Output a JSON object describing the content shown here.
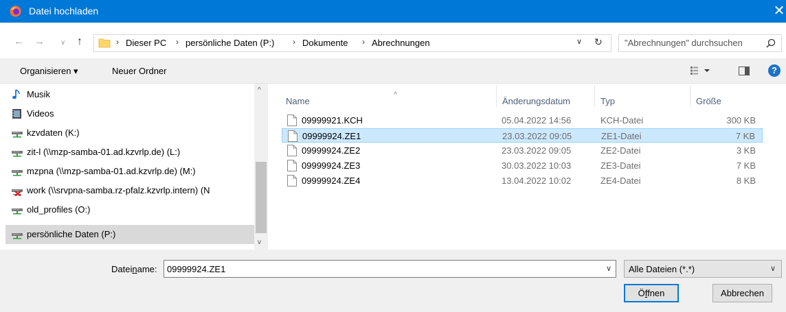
{
  "window": {
    "title": "Datei hochladen",
    "close": "✕"
  },
  "address": {
    "crumbs": [
      "Dieser PC",
      "persönliche Daten (P:)",
      "Dokumente",
      "Abrechnungen"
    ],
    "separator": "›",
    "search_placeholder": "\"Abrechnungen\" durchsuchen"
  },
  "toolbar": {
    "organize": "Organisieren ▾",
    "new_folder": "Neuer Ordner"
  },
  "nav": {
    "items": [
      {
        "label": "Musik",
        "icon": "music-icon"
      },
      {
        "label": "Videos",
        "icon": "video-icon"
      },
      {
        "label": "kzvdaten (K:)",
        "icon": "network-drive-icon"
      },
      {
        "label": "zit-l (\\\\mzp-samba-01.ad.kzvrlp.de) (L:)",
        "icon": "network-drive-icon"
      },
      {
        "label": "mzpna (\\\\mzp-samba-01.ad.kzvrlp.de) (M:)",
        "icon": "network-drive-icon"
      },
      {
        "label": "work (\\\\srvpna-samba.rz-pfalz.kzvrlp.intern) (N",
        "icon": "disconnected-drive-icon"
      },
      {
        "label": "old_profiles (O:)",
        "icon": "network-drive-icon"
      },
      {
        "label": "persönliche Daten (P:)",
        "icon": "network-drive-icon"
      }
    ],
    "selected_index": 7
  },
  "files": {
    "columns": {
      "name": "Name",
      "date": "Änderungsdatum",
      "type": "Typ",
      "size": "Größe"
    },
    "rows": [
      {
        "name": "09999921.KCH",
        "date": "05.04.2022 14:56",
        "type": "KCH-Datei",
        "size": "300 KB"
      },
      {
        "name": "09999924.ZE1",
        "date": "23.03.2022 09:05",
        "type": "ZE1-Datei",
        "size": "7 KB"
      },
      {
        "name": "09999924.ZE2",
        "date": "23.03.2022 09:05",
        "type": "ZE2-Datei",
        "size": "3 KB"
      },
      {
        "name": "09999924.ZE3",
        "date": "30.03.2022 10:03",
        "type": "ZE3-Datei",
        "size": "7 KB"
      },
      {
        "name": "09999924.ZE4",
        "date": "13.04.2022 10:02",
        "type": "ZE4-Datei",
        "size": "8 KB"
      }
    ],
    "selected_index": 1
  },
  "footer": {
    "filename_label_pre": "Datei",
    "filename_label_u": "n",
    "filename_label_post": "ame:",
    "filename_value": "09999924.ZE1",
    "filter": "Alle Dateien (*.*)",
    "open_pre": "Ö",
    "open_u": "f",
    "open_post": "fnen",
    "cancel": "Abbrechen"
  },
  "colors": {
    "accent": "#0078d7",
    "selection": "#cce8ff",
    "nav_selected": "#d9d9d9"
  }
}
